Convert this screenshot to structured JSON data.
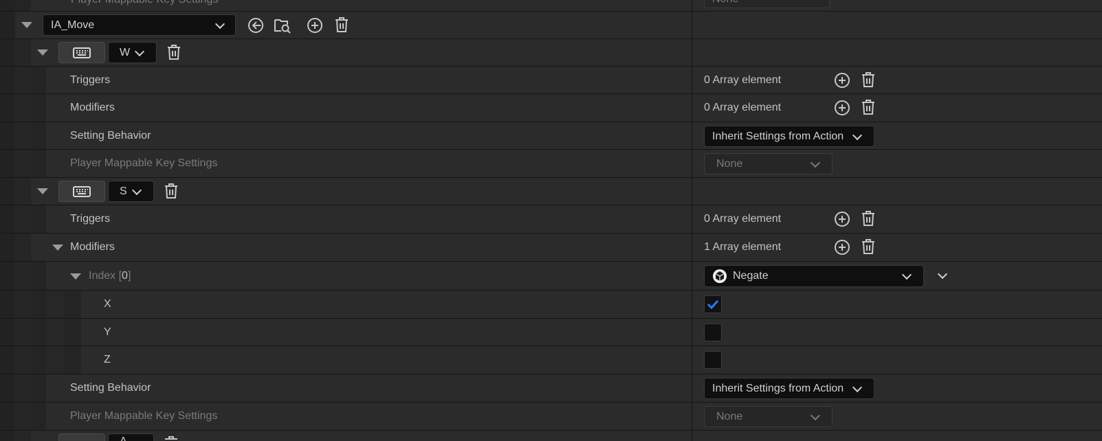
{
  "top_partial": {
    "label": "Player Mappable Key Settings",
    "value": "None"
  },
  "action": {
    "name": "IA_Move"
  },
  "mappings": [
    {
      "key": "W",
      "triggers": {
        "label": "Triggers",
        "value": "0 Array element"
      },
      "modifiers": {
        "label": "Modifiers",
        "value": "0 Array element"
      },
      "setting_behavior": {
        "label": "Setting Behavior",
        "value": "Inherit Settings from Action"
      },
      "player_mappable": {
        "label": "Player Mappable Key Settings",
        "value": "None"
      }
    },
    {
      "key": "S",
      "triggers": {
        "label": "Triggers",
        "value": "0 Array element"
      },
      "modifiers": {
        "label": "Modifiers",
        "value": "1 Array element"
      },
      "index": {
        "label": "Index",
        "bracket_open": "[",
        "number": "0",
        "bracket_close": "]",
        "value": "Negate"
      },
      "axes": [
        {
          "label": "X",
          "checked": true
        },
        {
          "label": "Y",
          "checked": false
        },
        {
          "label": "Z",
          "checked": false
        }
      ],
      "setting_behavior": {
        "label": "Setting Behavior",
        "value": "Inherit Settings from Action"
      },
      "player_mappable": {
        "label": "Player Mappable Key Settings",
        "value": "None"
      }
    }
  ],
  "bottom_partial": {
    "key": "A"
  },
  "icons": {
    "expand": "triangle-down-icon",
    "add": "plus-circle-icon",
    "delete": "trash-icon",
    "back": "arrow-left-circle-icon",
    "browse": "folder-search-icon",
    "keyboard": "keyboard-icon",
    "modifier": "cube-icon",
    "check": "checkmark-icon"
  },
  "colors": {
    "panel": "#2b2b2b",
    "rail": "#222222",
    "field": "#0f0f0f",
    "check": "#2b7bff"
  }
}
